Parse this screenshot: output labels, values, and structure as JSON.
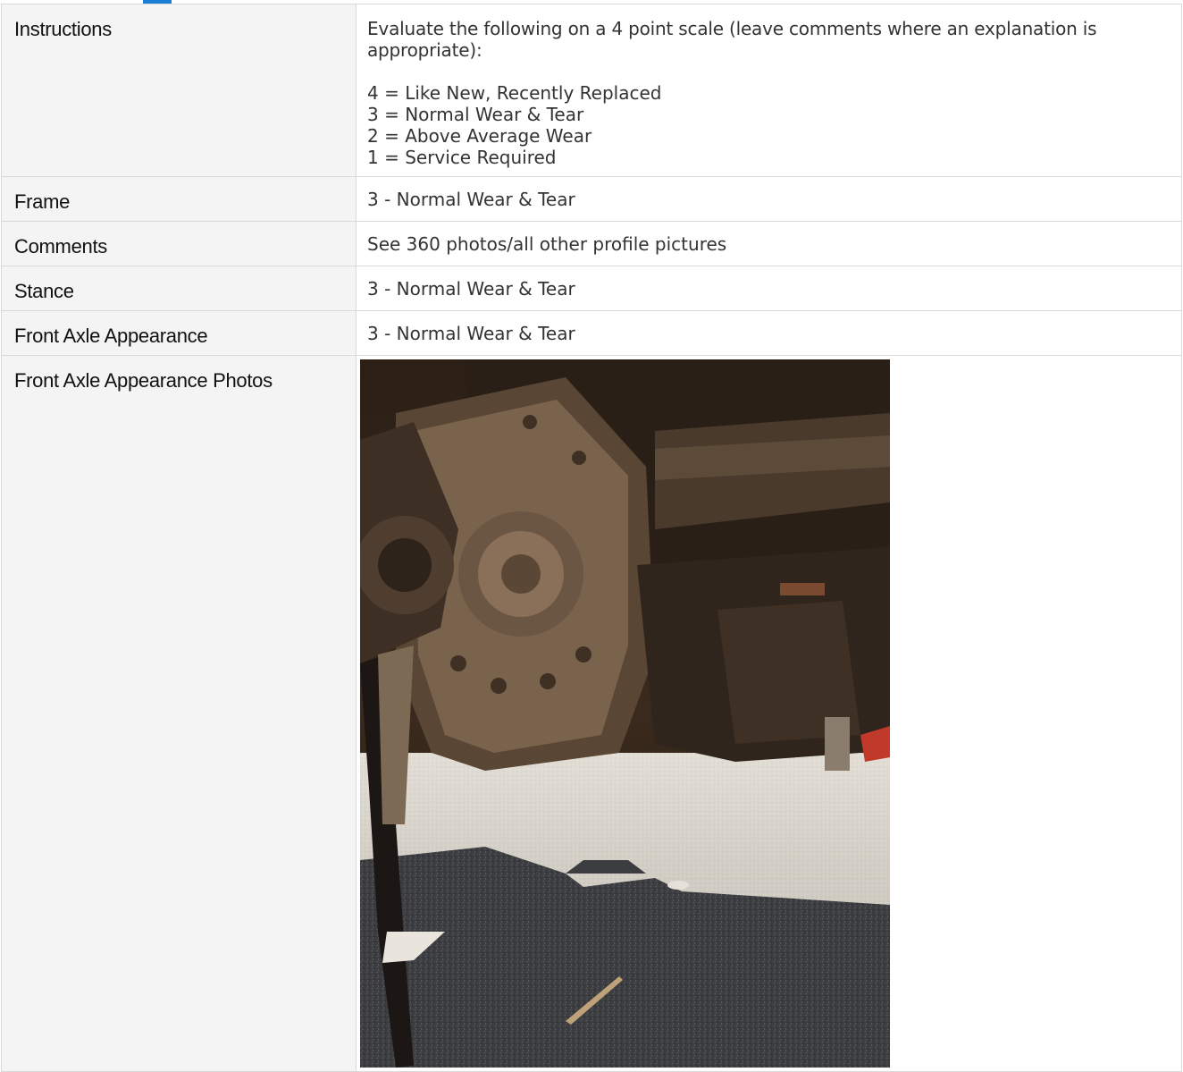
{
  "report": {
    "rows": {
      "instructions": {
        "label": "Instructions",
        "intro": "Evaluate the following on a 4 point scale (leave comments where an explanation is appropriate):",
        "scale": [
          "4 = Like New, Recently Replaced",
          "3 = Normal Wear & Tear",
          "2 = Above Average Wear",
          "1 = Service Required"
        ]
      },
      "frame": {
        "label": "Frame",
        "value": "3 - Normal Wear & Tear"
      },
      "comments": {
        "label": "Comments",
        "value": "See 360 photos/all other profile pictures"
      },
      "stance": {
        "label": "Stance",
        "value": "3 - Normal Wear & Tear"
      },
      "front_axle_appearance": {
        "label": "Front Axle Appearance",
        "value": "3 - Normal Wear & Tear"
      },
      "front_axle_appearance_photos": {
        "label": "Front Axle Appearance Photos"
      }
    }
  },
  "colors": {
    "accent": "#1a7fd4",
    "label_background": "#f4f4f4",
    "border": "#d9d9d9"
  }
}
